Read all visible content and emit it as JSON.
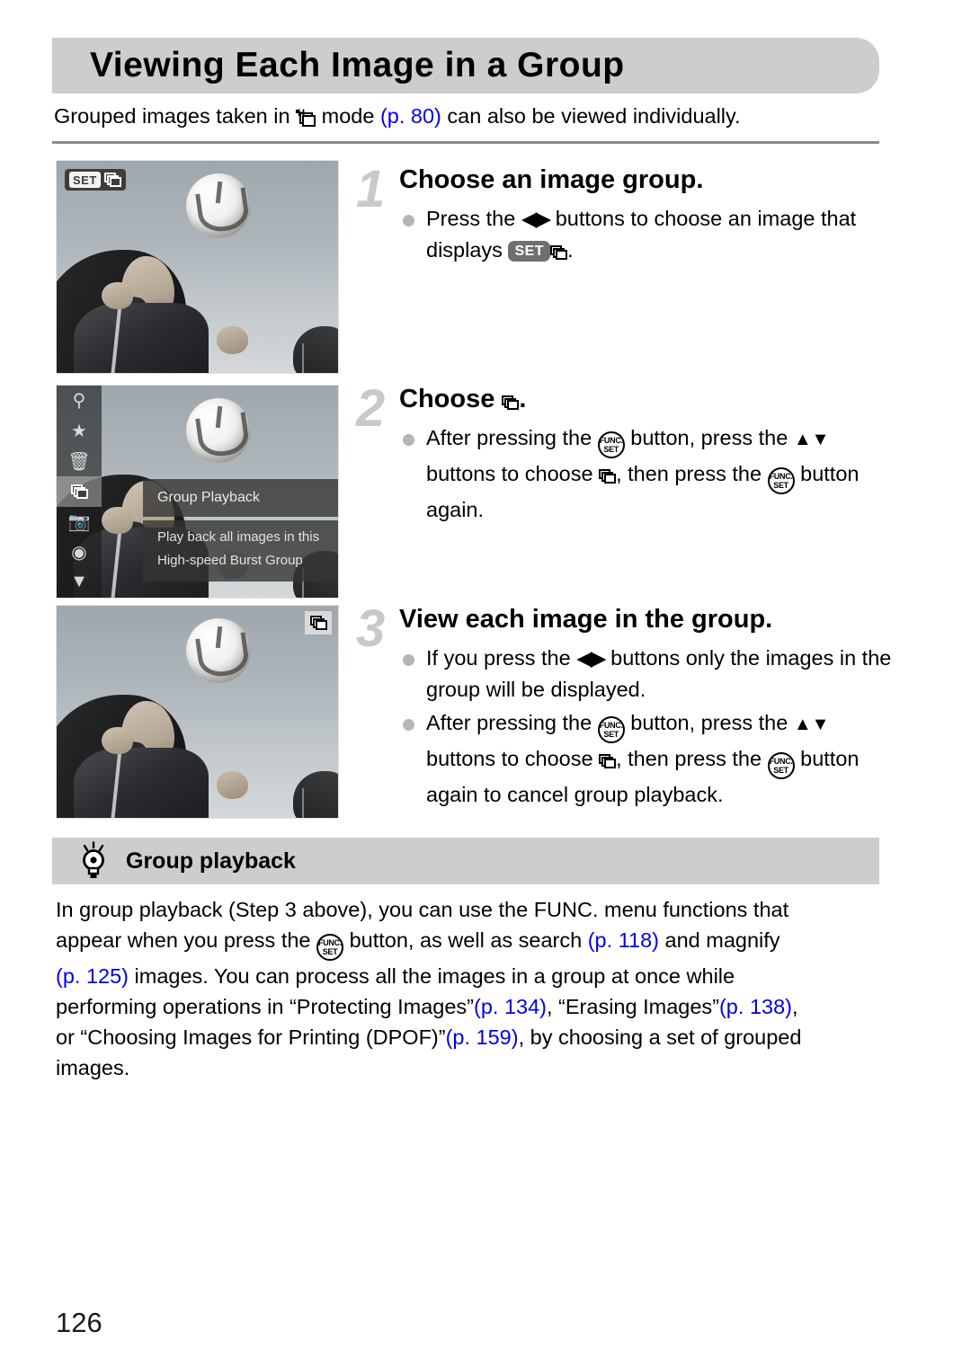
{
  "page": {
    "title": "Viewing Each Image in a Group",
    "number": "126"
  },
  "intro": {
    "part1": "Grouped images taken in",
    "icon": "high-speed-burst-icon",
    "part2": "mode",
    "page_ref": "(p. 80)",
    "part3": "can also be viewed individually."
  },
  "steps": [
    {
      "number": "1",
      "heading": "Choose an image group.",
      "bullets": [
        {
          "seg1": "Press the",
          "icon1": "left-right-arrows-icon",
          "seg2": "buttons to choose an image that displays",
          "icon2": "set-badge-icon",
          "icon3": "stacked-frames-icon",
          "seg3": "."
        }
      ]
    },
    {
      "number": "2",
      "heading_prefix": "Choose",
      "heading_icon": "stacked-frames-icon",
      "heading_suffix": ".",
      "bullets": [
        {
          "seg1": "After pressing the",
          "icon1": "func-set-button-icon",
          "seg2": "button, press the",
          "icon2": "up-down-arrows-icon",
          "seg3": "buttons to choose",
          "icon3": "stacked-frames-icon",
          "seg4": ", then press the",
          "icon4": "func-set-button-icon",
          "seg5": "button again."
        }
      ]
    },
    {
      "number": "3",
      "heading": "View each image in the group.",
      "bullets": [
        {
          "seg1": "If you press the",
          "icon1": "left-right-arrows-icon",
          "seg2": "buttons only the images in the group will be displayed."
        },
        {
          "seg1": "After pressing the",
          "icon1": "func-set-button-icon",
          "seg2": "button, press the",
          "icon2": "up-down-arrows-icon",
          "seg3": "buttons to choose",
          "icon3": "stacked-frames-icon",
          "seg4": ", then press the",
          "icon4": "func-set-button-icon",
          "seg5": "button again to cancel group playback."
        }
      ]
    }
  ],
  "tip": {
    "icon": "light-bulb-icon",
    "title": "Group playback",
    "line1_a": "In group playback (Step 3 above), you can use the FUNC. menu functions that",
    "line2_a": "appear when you press the",
    "line2_icon": "func-set-button-icon",
    "line2_b": "button, as well as search",
    "line2_ref": "(p. 118)",
    "line2_c": "and magnify",
    "line3_ref": "(p. 125)",
    "line3_a": "images. You can process all the images in a group at once while",
    "line4_a": "performing operations in “Protecting Images”",
    "line4_ref1": "(p. 134)",
    "line4_b": ", “Erasing Images”",
    "line4_ref2": "(p. 138)",
    "line4_c": ",",
    "line5_a": "or “Choosing Images for Printing (DPOF)”",
    "line5_ref": "(p. 159)",
    "line5_b": ", by choosing a set of grouped",
    "line6_a": "images."
  },
  "screenshots": {
    "shot1": {
      "name": "camera-screen-group-selected",
      "overlay_set_label": "SET",
      "overlay_icon": "stacked-frames-icon"
    },
    "shot2": {
      "name": "camera-screen-func-menu",
      "menu_title": "Group Playback",
      "menu_desc_line1": "Play back all images in this",
      "menu_desc_line2": "High-speed Burst Group",
      "sidebar_icons": [
        "key-protect-icon",
        "star-favorites-icon",
        "trash-erase-icon",
        "stacked-frames-group-playback-icon",
        "camera-rotate-icon",
        "slideshow-play-icon",
        "filter-jump-icon"
      ]
    },
    "shot3": {
      "name": "camera-screen-group-playback",
      "corner_icon": "stacked-frames-icon"
    }
  },
  "colors": {
    "header_bar": "#cdcdcd",
    "page_ref_link": "#0000e8",
    "step_number": "#c9c9c9",
    "bullet": "#b6b6b6",
    "rule": "#8a8a8a"
  }
}
